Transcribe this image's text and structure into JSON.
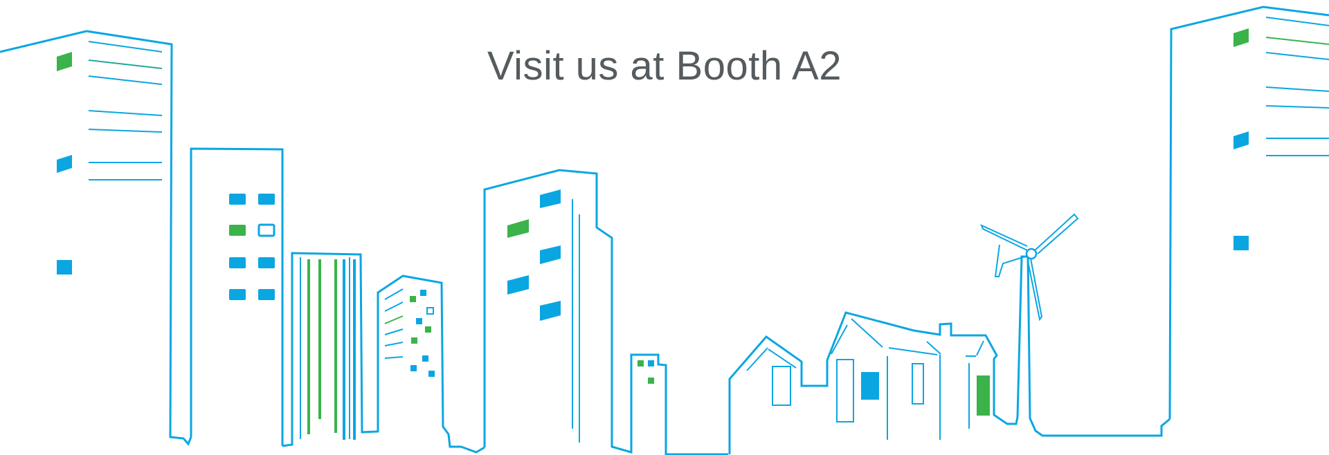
{
  "headline": "Visit us at Booth A2",
  "colors": {
    "outline_blue": "#0aa6e2",
    "window_green": "#3bb34a",
    "text_gray": "#555b5e",
    "background": "#ffffff"
  },
  "icons": {
    "scene": "city-skyline-line-art",
    "turbine": "wind-turbine"
  }
}
